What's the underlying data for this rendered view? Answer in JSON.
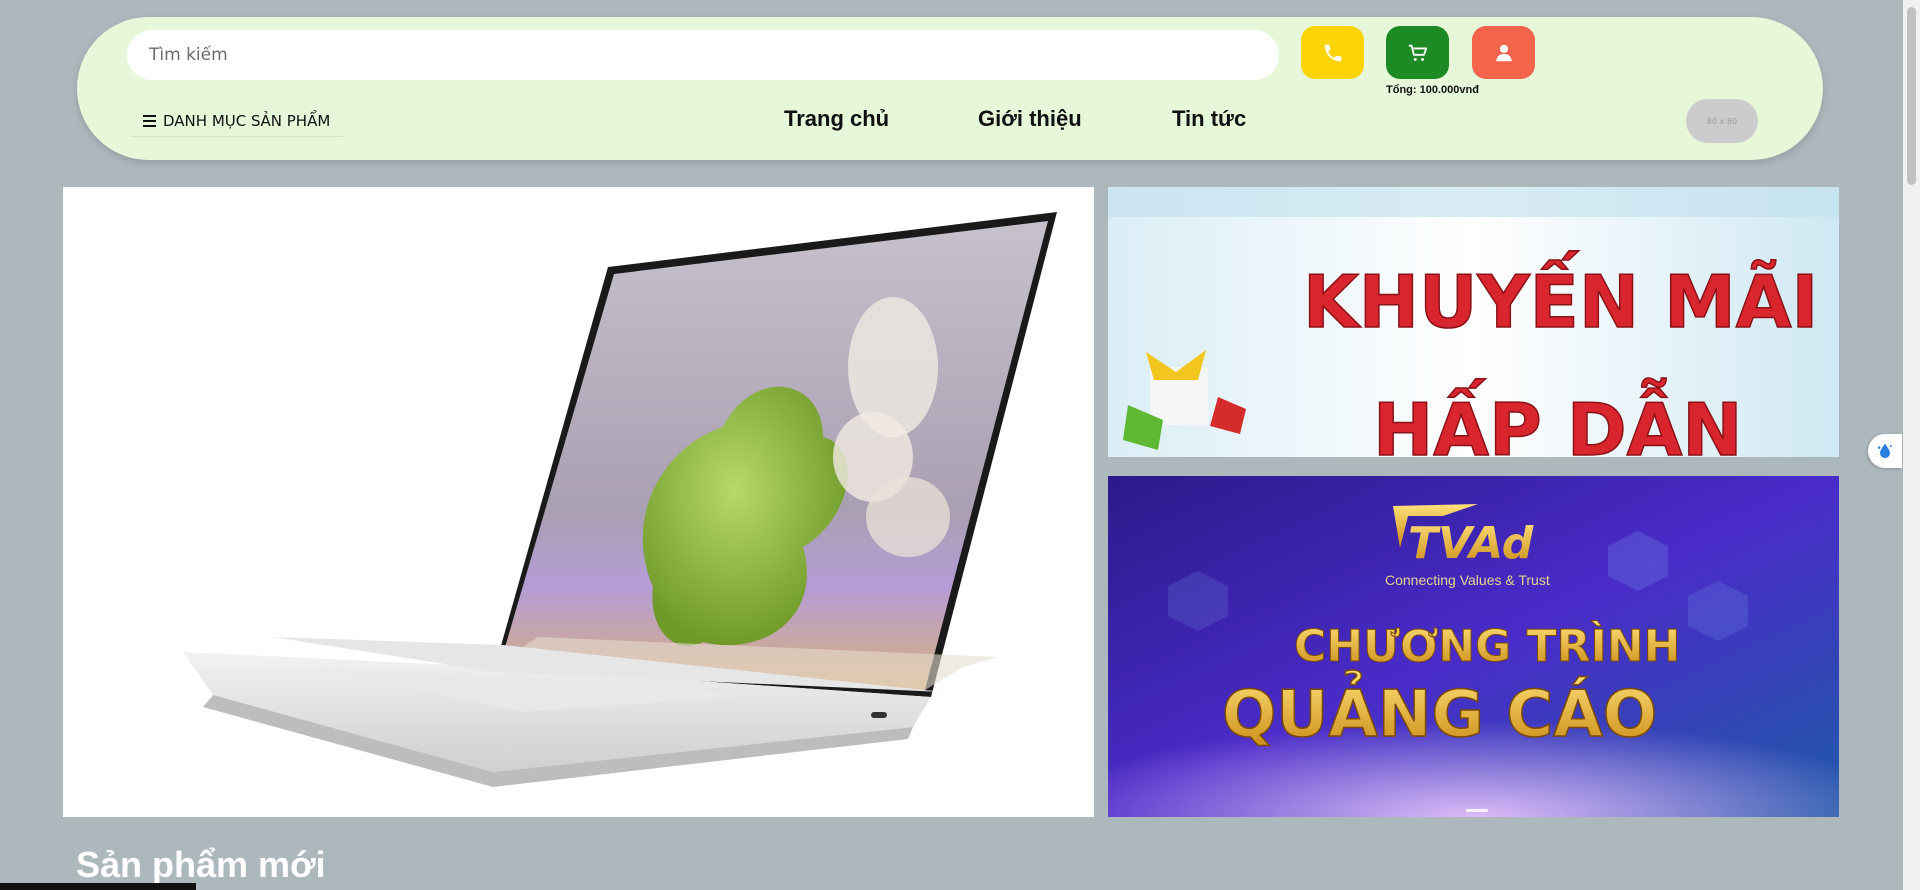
{
  "header": {
    "search": {
      "placeholder": "Tìm kiếm"
    },
    "cart": {
      "total_text": "Tổng: 100.000vnđ"
    },
    "category_label": "DANH MỤC SẢN PHẨM",
    "nav": [
      {
        "label": "Trang chủ"
      },
      {
        "label": "Giới thiệu"
      },
      {
        "label": "Tin tức"
      }
    ],
    "avatar_placeholder": "80 x 80"
  },
  "banners": {
    "promo": {
      "line1": "KHUYẾN MÃI",
      "line2": "HẤP DẪN"
    },
    "ads": {
      "brand": "TVAd",
      "tagline": "Connecting Values & Trust",
      "line1": "CHƯƠNG TRÌNH",
      "line2": "QUẢNG CÁO"
    }
  },
  "main": {
    "section_title": "Sản phẩm mới"
  },
  "colors": {
    "page_bg": "#adb8bd",
    "header_bg": "#e6f7da",
    "phone_btn": "#ffd404",
    "cart_btn": "#1d8a24",
    "user_btn": "#f4634b"
  },
  "icons": [
    "phone-icon",
    "cart-icon",
    "user-icon",
    "menu-icon",
    "water-drop-icon"
  ]
}
